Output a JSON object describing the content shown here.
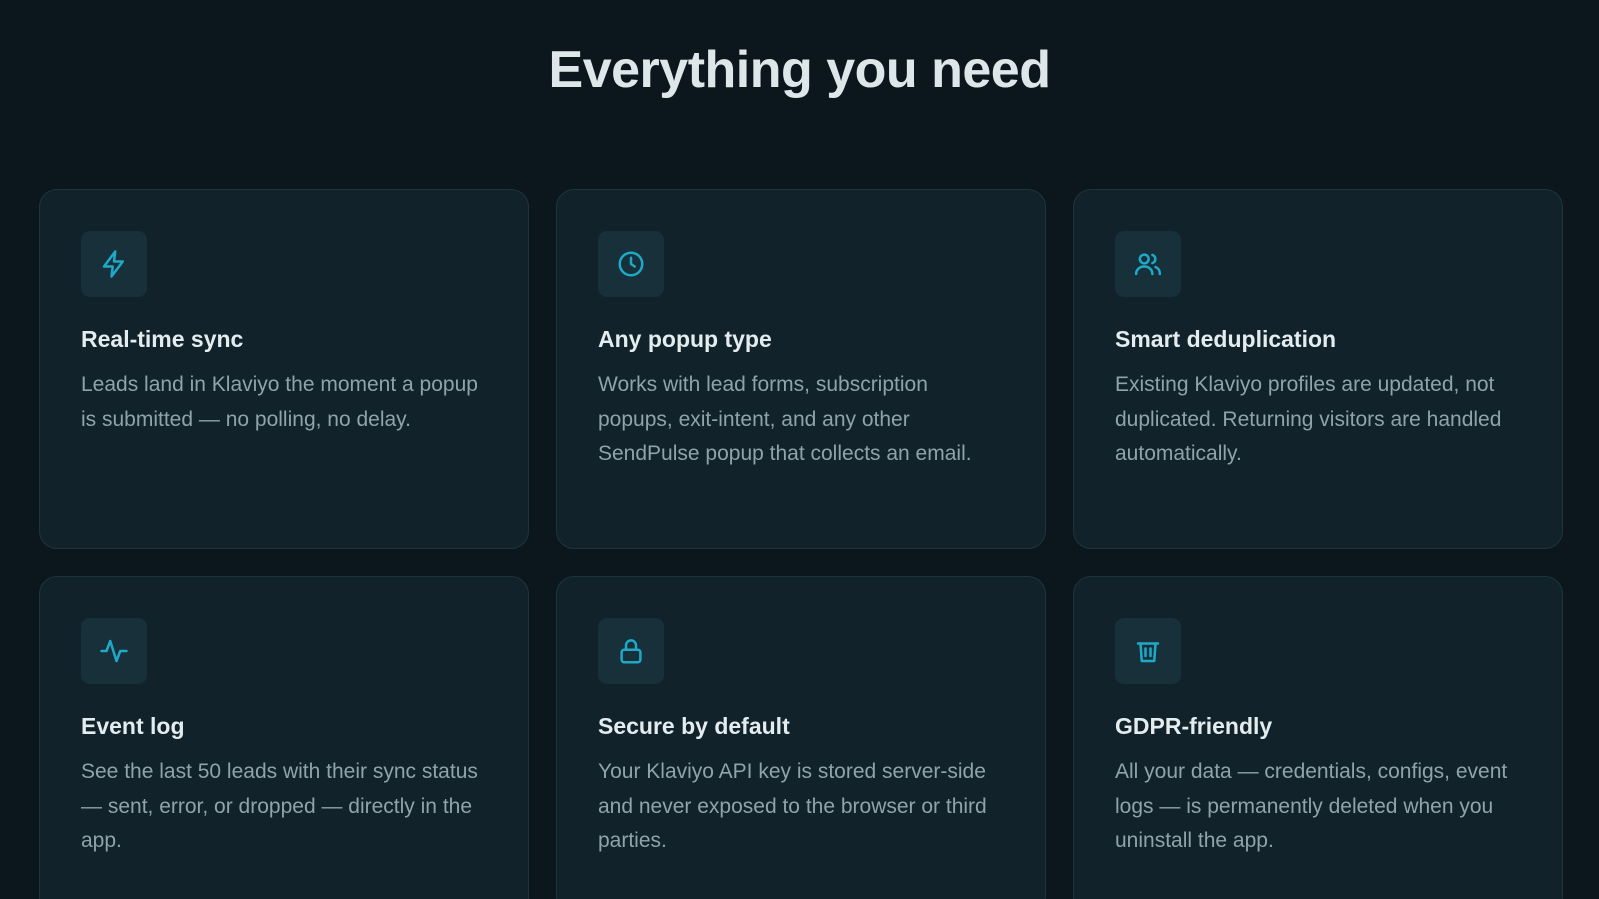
{
  "heading": "Everything you need",
  "accent_color": "#1fa9c9",
  "features": [
    {
      "icon": "lightning-icon",
      "title": "Real-time sync",
      "description": "Leads land in Klaviyo the moment a popup is submitted — no polling, no delay."
    },
    {
      "icon": "clock-icon",
      "title": "Any popup type",
      "description": "Works with lead forms, subscription popups, exit-intent, and any other SendPulse popup that collects an email."
    },
    {
      "icon": "users-icon",
      "title": "Smart deduplication",
      "description": "Existing Klaviyo profiles are updated, not duplicated. Returning visitors are handled automatically."
    },
    {
      "icon": "activity-icon",
      "title": "Event log",
      "description": "See the last 50 leads with their sync status — sent, error, or dropped — directly in the app."
    },
    {
      "icon": "lock-icon",
      "title": "Secure by default",
      "description": "Your Klaviyo API key is stored server-side and never exposed to the browser or third parties."
    },
    {
      "icon": "trash-icon",
      "title": "GDPR-friendly",
      "description": "All your data — credentials, configs, event logs — is permanently deleted when you uninstall the app."
    }
  ]
}
